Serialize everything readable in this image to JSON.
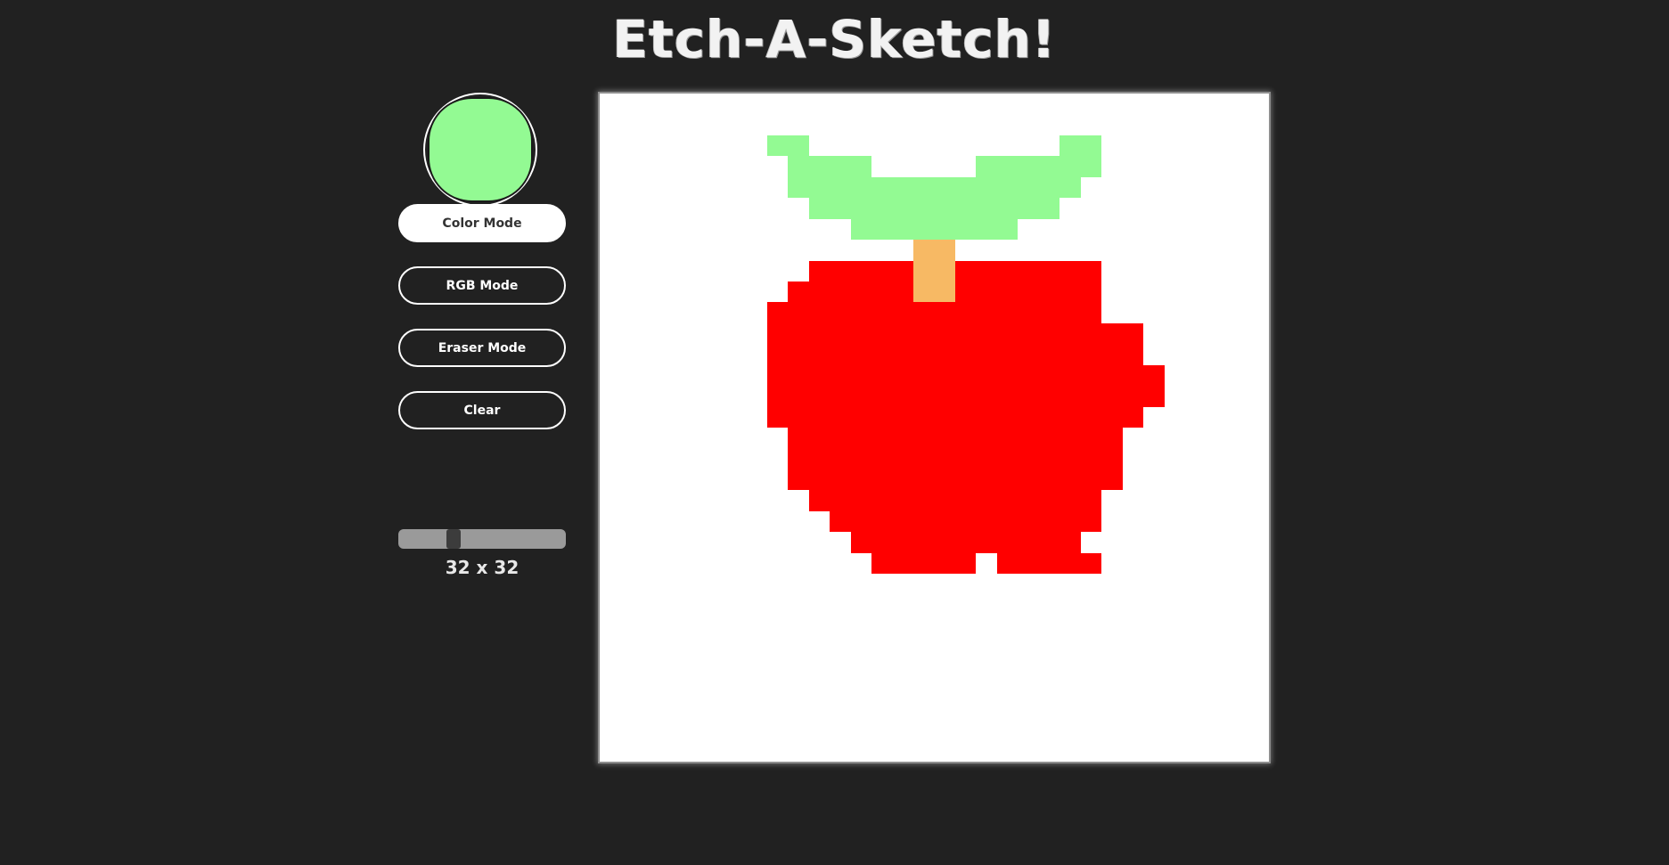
{
  "header": {
    "title": "Etch-A-Sketch!"
  },
  "controls": {
    "current_color": "#93fa93",
    "buttons": [
      {
        "id": "color-mode",
        "label": "Color Mode",
        "active": true
      },
      {
        "id": "rgb-mode",
        "label": "RGB Mode",
        "active": false
      },
      {
        "id": "eraser-mode",
        "label": "Eraser Mode",
        "active": false
      },
      {
        "id": "clear",
        "label": "Clear",
        "active": false
      }
    ],
    "grid_size": {
      "label": "32 x 32",
      "value": 32,
      "min": 1,
      "max": 100
    }
  },
  "board": {
    "background": "#ffffff",
    "palette": {
      "L": "#93fa93",
      "S": "#f7b964",
      "R": "#ff0000"
    },
    "pixels": [
      "................................",
      "................................",
      "........LL............LL........",
      ".........LLLL.....LLLLLL........",
      ".........LLLLLLLLLLLLLL.........",
      "..........LLLLLLLLLLLL..........",
      "............LLLLLLLL............",
      "...............SS...............",
      "..........RRRRRSSRRRRRRR........",
      ".........RRRRRRSSRRRRRRR........",
      "........RRRRRRRRRRRRRRRR........",
      "........RRRRRRRRRRRRRRRRRR......",
      "........RRRRRRRRRRRRRRRRRR......",
      "........RRRRRRRRRRRRRRRRRRR.....",
      "........RRRRRRRRRRRRRRRRRRR.....",
      "........RRRRRRRRRRRRRRRRRR......",
      ".........RRRRRRRRRRRRRRRR.......",
      ".........RRRRRRRRRRRRRRRR.......",
      ".........RRRRRRRRRRRRRRRR.......",
      "..........RRRRRRRRRRRRRR........",
      "...........RRRRRRRRRRRRR........",
      "............RRRRRRRRRRR.........",
      ".............RRRRR.RRRRR........",
      "................................",
      "................................",
      "................................",
      "................................",
      "................................",
      "................................",
      "................................",
      "................................",
      "................................"
    ]
  }
}
